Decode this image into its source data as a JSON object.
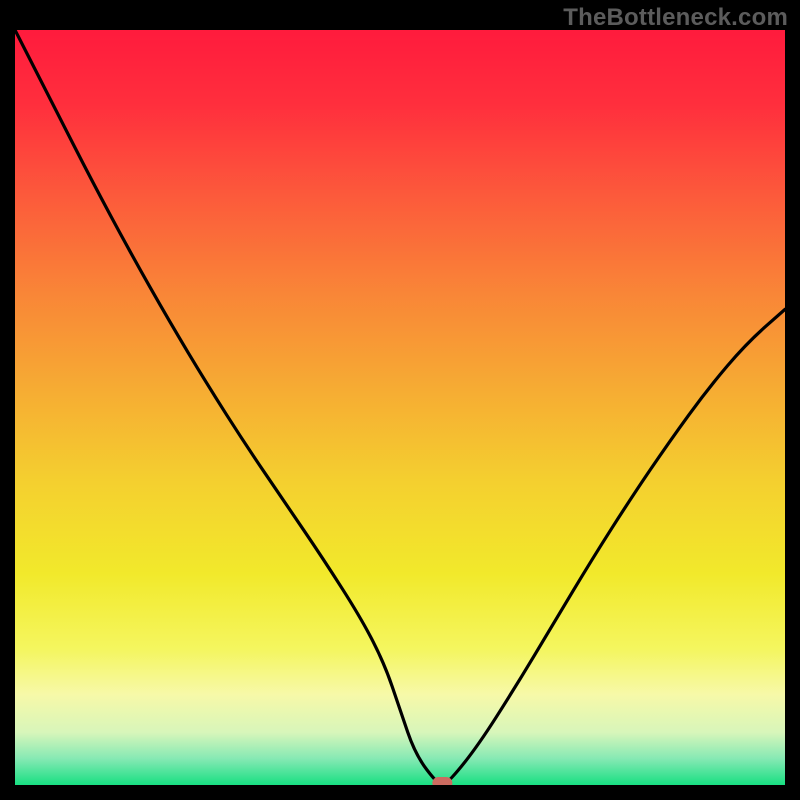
{
  "watermark": "TheBottleneck.com",
  "chart_data": {
    "type": "line",
    "title": "",
    "xlabel": "",
    "ylabel": "",
    "xlim": [
      0,
      100
    ],
    "ylim": [
      0,
      100
    ],
    "grid": false,
    "series": [
      {
        "name": "bottleneck-curve",
        "x": [
          0,
          5,
          10,
          15,
          20,
          25,
          30,
          35,
          40,
          45,
          48,
          50,
          52,
          55,
          56,
          60,
          65,
          70,
          75,
          80,
          85,
          90,
          95,
          100
        ],
        "y": [
          100,
          90,
          80,
          70.5,
          61.5,
          53,
          45,
          37.5,
          30,
          22,
          16,
          10,
          4,
          0,
          0,
          5,
          13,
          21.5,
          30,
          38,
          45.5,
          52.5,
          58.5,
          63
        ]
      }
    ],
    "marker": {
      "x": 55.5,
      "y": 0
    },
    "gradient_stops": [
      {
        "offset": 0.0,
        "color": "#ff1b3d"
      },
      {
        "offset": 0.1,
        "color": "#ff2f3d"
      },
      {
        "offset": 0.22,
        "color": "#fc5a3b"
      },
      {
        "offset": 0.35,
        "color": "#f98637"
      },
      {
        "offset": 0.48,
        "color": "#f6ad33"
      },
      {
        "offset": 0.6,
        "color": "#f4d02f"
      },
      {
        "offset": 0.72,
        "color": "#f2e92b"
      },
      {
        "offset": 0.82,
        "color": "#f4f65f"
      },
      {
        "offset": 0.88,
        "color": "#f7f9a8"
      },
      {
        "offset": 0.93,
        "color": "#d8f6ba"
      },
      {
        "offset": 0.965,
        "color": "#86e9b4"
      },
      {
        "offset": 1.0,
        "color": "#18df82"
      }
    ]
  }
}
